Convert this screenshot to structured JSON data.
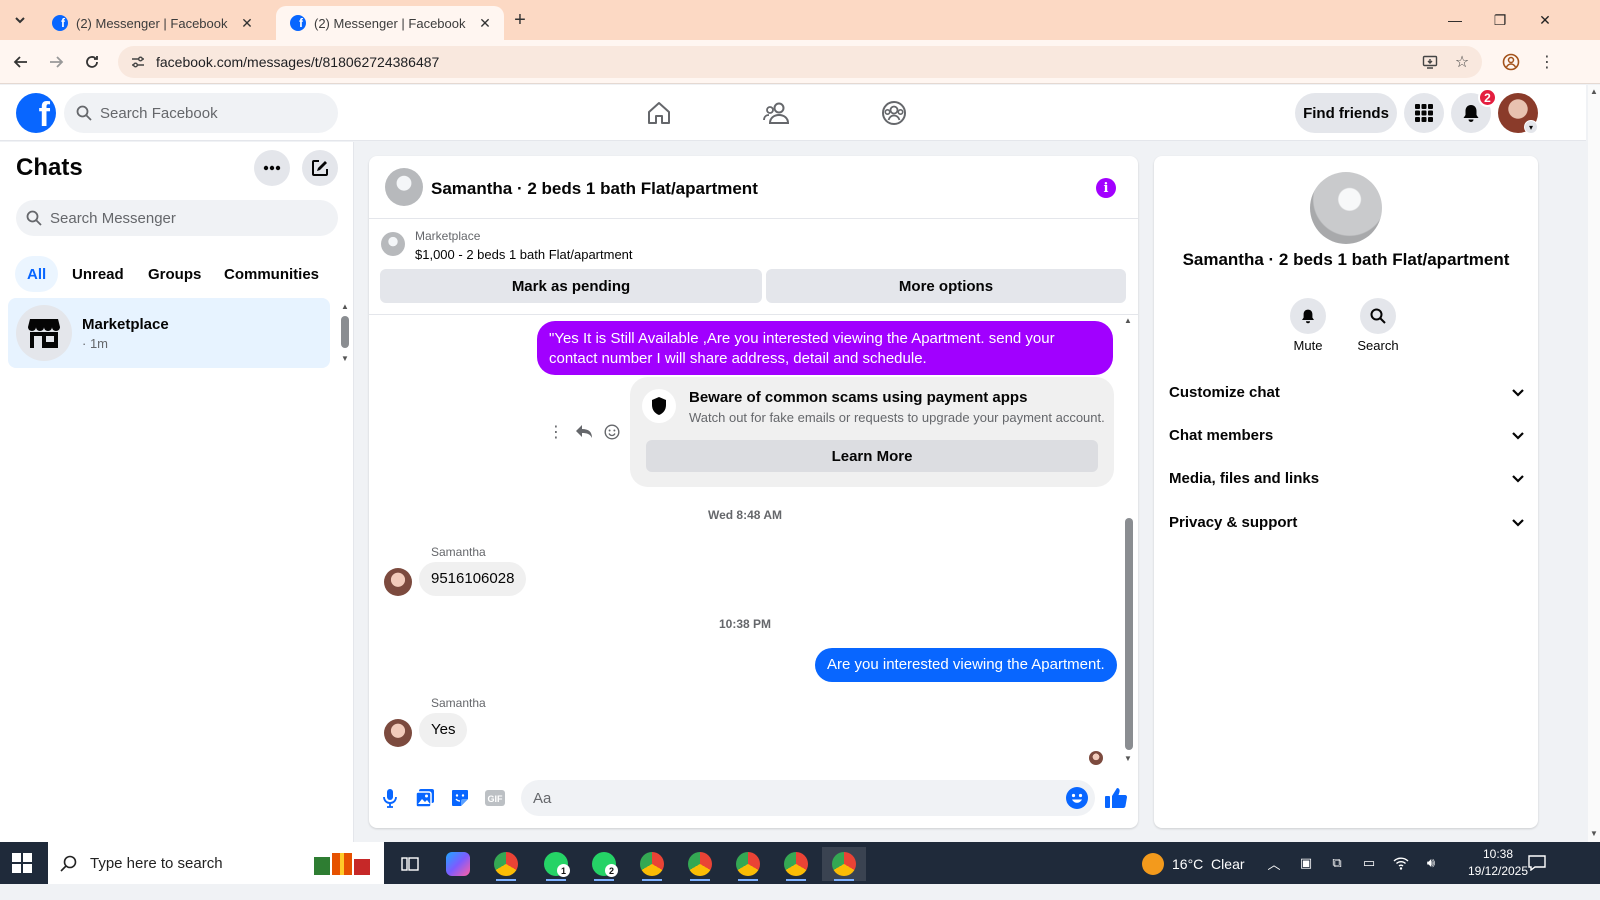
{
  "browser": {
    "tabs": [
      {
        "title": "(2) Messenger | Facebook",
        "active": false
      },
      {
        "title": "(2) Messenger | Facebook",
        "active": true
      }
    ],
    "url": "facebook.com/messages/t/818062724386487"
  },
  "header": {
    "search_placeholder": "Search Facebook",
    "find_friends_label": "Find friends",
    "notification_count": "2"
  },
  "sidebar": {
    "title": "Chats",
    "search_placeholder": "Search Messenger",
    "filters": [
      "All",
      "Unread",
      "Groups",
      "Communities"
    ],
    "active_filter": "All",
    "chats": [
      {
        "name": "Marketplace",
        "meta": "· 1m"
      }
    ]
  },
  "conversation": {
    "title": "Samantha · 2 beds 1 bath Flat/apartment",
    "marketplace_label": "Marketplace",
    "listing": "$1,000 - 2 beds 1 bath Flat/apartment",
    "mark_pending_label": "Mark as pending",
    "more_options_label": "More options",
    "messages": [
      {
        "type": "outgoing",
        "text": "\"Yes It is Still Available ,Are you interested viewing the Apartment. send your contact number I will share address, detail and schedule."
      },
      {
        "type": "warning",
        "title": "Beware of common scams using payment apps",
        "text": "Watch out for fake emails or requests to upgrade your payment account.",
        "action": "Learn More"
      },
      {
        "type": "timestamp",
        "text": "Wed 8:48 AM"
      },
      {
        "type": "incoming",
        "sender": "Samantha",
        "text": "9516106028"
      },
      {
        "type": "timestamp",
        "text": "10:38 PM"
      },
      {
        "type": "outgoing",
        "text": "Are you interested viewing the Apartment."
      },
      {
        "type": "incoming",
        "sender": "Samantha",
        "text": "Yes"
      }
    ],
    "composer_placeholder": "Aa",
    "gif_label": "GIF"
  },
  "info_panel": {
    "name": "Samantha · 2 beds 1 bath Flat/apartment",
    "actions": [
      {
        "label": "Mute",
        "icon": "bell-icon"
      },
      {
        "label": "Search",
        "icon": "search-icon"
      }
    ],
    "sections": [
      "Customize chat",
      "Chat members",
      "Media, files and links",
      "Privacy & support"
    ]
  },
  "taskbar": {
    "search_placeholder": "Type here to search",
    "weather": "16°C  Clear",
    "time": "10:38",
    "date": "19/12/2025",
    "whatsapp_counts": [
      "1",
      "2"
    ]
  },
  "colors": {
    "facebook_blue": "#0866ff",
    "outgoing_purple": "#a100ff",
    "info_purple": "#a200ff",
    "tabbar_bg": "#fcd9c4",
    "taskbar_bg": "#1f2a3a",
    "notification_red": "#e41e3f"
  }
}
